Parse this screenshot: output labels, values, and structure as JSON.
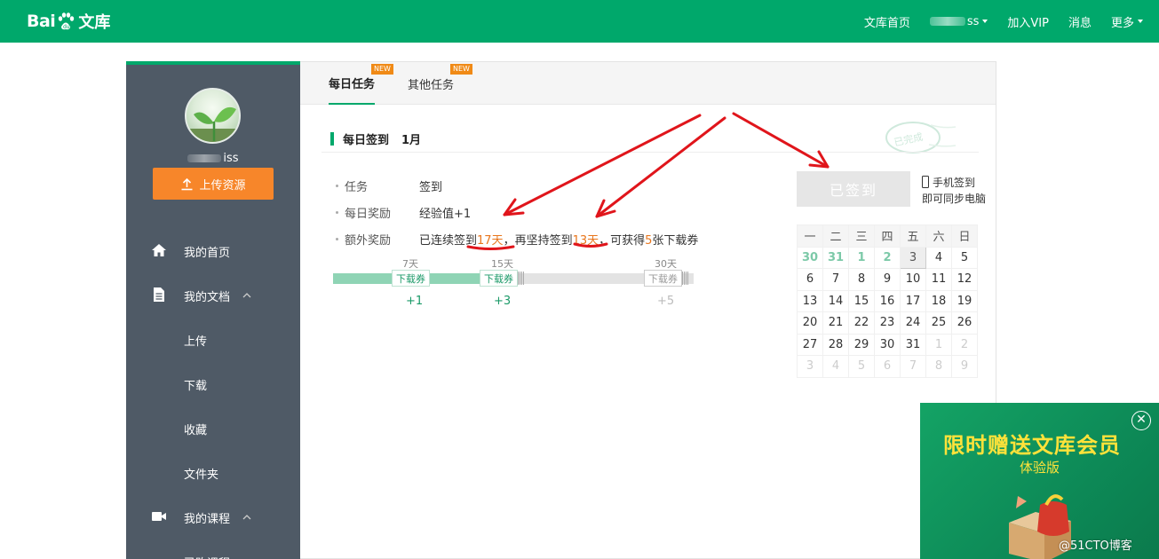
{
  "topnav": {
    "logo_bai": "Bai",
    "logo_wk": "文库",
    "items": [
      "文库首页",
      "ss",
      "加入VIP",
      "消息",
      "更多"
    ]
  },
  "sidebar": {
    "username": "iss",
    "upload_label": "上传资源",
    "menu": [
      {
        "label": "我的首页",
        "icon": "home-icon"
      },
      {
        "label": "我的文档",
        "icon": "document-icon"
      },
      {
        "label": "上传"
      },
      {
        "label": "下载"
      },
      {
        "label": "收藏"
      },
      {
        "label": "文件夹"
      },
      {
        "label": "我的课程",
        "icon": "video-icon"
      },
      {
        "label": "已购课程"
      }
    ]
  },
  "tabs": [
    {
      "label": "每日任务",
      "badge": "NEW"
    },
    {
      "label": "其他任务",
      "badge": "NEW"
    }
  ],
  "signin": {
    "title": "每日签到",
    "month": "1月",
    "stamp": "已完成",
    "rows": [
      {
        "key": "任务",
        "value": "签到"
      },
      {
        "key": "每日奖励",
        "value": "经验值+1"
      },
      {
        "key": "额外奖励",
        "parts": [
          "已连续签到",
          "17天",
          "，再坚持签到",
          "13天",
          "，可获得",
          "5",
          "张下载券"
        ]
      }
    ],
    "consecutive_days": 17,
    "progress_fraction": 0.5,
    "milestones": [
      {
        "days": "7天",
        "ticket": "下载券",
        "reward": "+1"
      },
      {
        "days": "15天",
        "ticket": "下载券",
        "reward": "+3"
      },
      {
        "days": "30天",
        "ticket": "下载券",
        "reward": "+5"
      }
    ],
    "button": "已签到",
    "mobile_line1": "手机签到",
    "mobile_line2": "即可同步电脑"
  },
  "calendar": {
    "weekdays": [
      "一",
      "二",
      "三",
      "四",
      "五",
      "六",
      "日"
    ],
    "weeks": [
      [
        "30",
        "31",
        "1",
        "2",
        "3",
        "4",
        "5"
      ],
      [
        "6",
        "7",
        "8",
        "9",
        "10",
        "11",
        "12"
      ],
      [
        "13",
        "14",
        "15",
        "16",
        "17",
        "18",
        "19"
      ],
      [
        "20",
        "21",
        "22",
        "23",
        "24",
        "25",
        "26"
      ],
      [
        "27",
        "28",
        "29",
        "30",
        "31",
        "1",
        "2"
      ],
      [
        "3",
        "4",
        "5",
        "6",
        "7",
        "8",
        "9"
      ]
    ]
  },
  "ad": {
    "title": "限时赠送文库会员",
    "subtitle": "体验版"
  },
  "watermark": "@51CTO博客",
  "colors": {
    "brand_green": "#00a86b",
    "sidebar": "#4f5a66",
    "upload_orange": "#f7862a",
    "highlight_orange": "#e8761d"
  }
}
